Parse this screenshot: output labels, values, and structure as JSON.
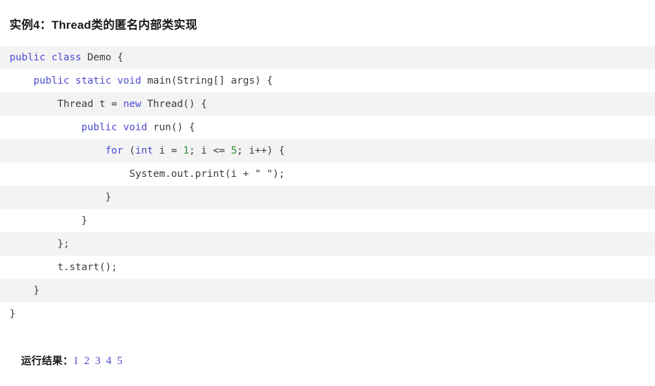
{
  "title": "实例4：Thread类的匿名内部类实现",
  "code": {
    "language": "java",
    "lines": [
      {
        "indent": 0,
        "stripe": "gray",
        "tokens": [
          {
            "t": "public",
            "k": "kw"
          },
          {
            "t": " ",
            "k": "plain"
          },
          {
            "t": "class",
            "k": "kw"
          },
          {
            "t": " Demo {",
            "k": "plain"
          }
        ]
      },
      {
        "indent": 1,
        "stripe": "white",
        "tokens": [
          {
            "t": "public",
            "k": "kw"
          },
          {
            "t": " ",
            "k": "plain"
          },
          {
            "t": "static",
            "k": "kw"
          },
          {
            "t": " ",
            "k": "plain"
          },
          {
            "t": "void",
            "k": "kw"
          },
          {
            "t": " main(String[] args) {",
            "k": "plain"
          }
        ]
      },
      {
        "indent": 2,
        "stripe": "gray",
        "tokens": [
          {
            "t": "Thread t = ",
            "k": "plain"
          },
          {
            "t": "new",
            "k": "kw"
          },
          {
            "t": " Thread() {",
            "k": "plain"
          }
        ]
      },
      {
        "indent": 3,
        "stripe": "white",
        "tokens": [
          {
            "t": "public",
            "k": "kw"
          },
          {
            "t": " ",
            "k": "plain"
          },
          {
            "t": "void",
            "k": "kw"
          },
          {
            "t": " run() {",
            "k": "plain"
          }
        ]
      },
      {
        "indent": 4,
        "stripe": "gray",
        "tokens": [
          {
            "t": "for",
            "k": "kw"
          },
          {
            "t": " (",
            "k": "plain"
          },
          {
            "t": "int",
            "k": "kw"
          },
          {
            "t": " i = ",
            "k": "plain"
          },
          {
            "t": "1",
            "k": "num"
          },
          {
            "t": "; i <= ",
            "k": "plain"
          },
          {
            "t": "5",
            "k": "num"
          },
          {
            "t": "; i++) {",
            "k": "plain"
          }
        ]
      },
      {
        "indent": 5,
        "stripe": "white",
        "tokens": [
          {
            "t": "System.out.print(i + ",
            "k": "plain"
          },
          {
            "t": "\" \"",
            "k": "str"
          },
          {
            "t": ");",
            "k": "plain"
          }
        ]
      },
      {
        "indent": 4,
        "stripe": "gray",
        "tokens": [
          {
            "t": "}",
            "k": "plain"
          }
        ]
      },
      {
        "indent": 3,
        "stripe": "white",
        "tokens": [
          {
            "t": "}",
            "k": "plain"
          }
        ]
      },
      {
        "indent": 2,
        "stripe": "gray",
        "tokens": [
          {
            "t": "};",
            "k": "plain"
          }
        ]
      },
      {
        "indent": 2,
        "stripe": "white",
        "tokens": [
          {
            "t": "t.start();",
            "k": "plain"
          }
        ]
      },
      {
        "indent": 1,
        "stripe": "gray",
        "tokens": [
          {
            "t": "}",
            "k": "plain"
          }
        ]
      },
      {
        "indent": 0,
        "stripe": "white",
        "tokens": [
          {
            "t": "}",
            "k": "plain"
          }
        ]
      }
    ]
  },
  "result": {
    "label": "运行结果：",
    "value": "1 2 3 4 5"
  },
  "colors": {
    "keyword": "#4b4bd2",
    "number": "#2e8b2e",
    "text": "#3b3b3b",
    "stripe": "#f3f3f4",
    "background": "#ffffff",
    "heading": "#1a1a1a",
    "result_value": "#4b4bd2"
  }
}
